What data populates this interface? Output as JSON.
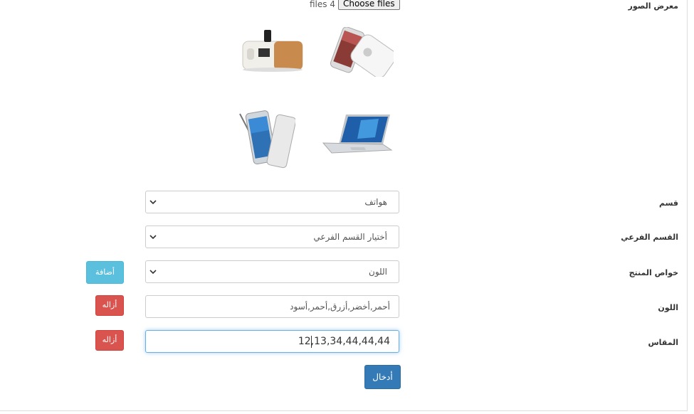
{
  "form": {
    "gallery_label": "معرض الصور",
    "file_count_text": "files 4",
    "choose_files_label": "Choose files",
    "category_label": "قسم",
    "category_value": "هواتف",
    "subcategory_label": "القسم الفرعي",
    "subcategory_value": "أختيار القسم الفرعي",
    "properties_label": "خواص المنتج",
    "properties_value": "اللون",
    "add_button": "أضافة",
    "color_label": "اللون",
    "color_value": "أحمر,أخضر,أزرق,أحمر,أسود",
    "remove_button_color": "أزاله",
    "size_label": "المقاس",
    "size_value": "12,13,34,44,44,44",
    "remove_button_size": "أزاله",
    "submit_button": "أدخال"
  },
  "gallery": {
    "images": [
      "speaker-dock-image",
      "smartphone-image",
      "stylus-phone-image",
      "laptop-image"
    ]
  },
  "colors": {
    "info": "#5bc0de",
    "danger": "#d9534f",
    "primary": "#337ab7",
    "focus": "#66afe9"
  }
}
